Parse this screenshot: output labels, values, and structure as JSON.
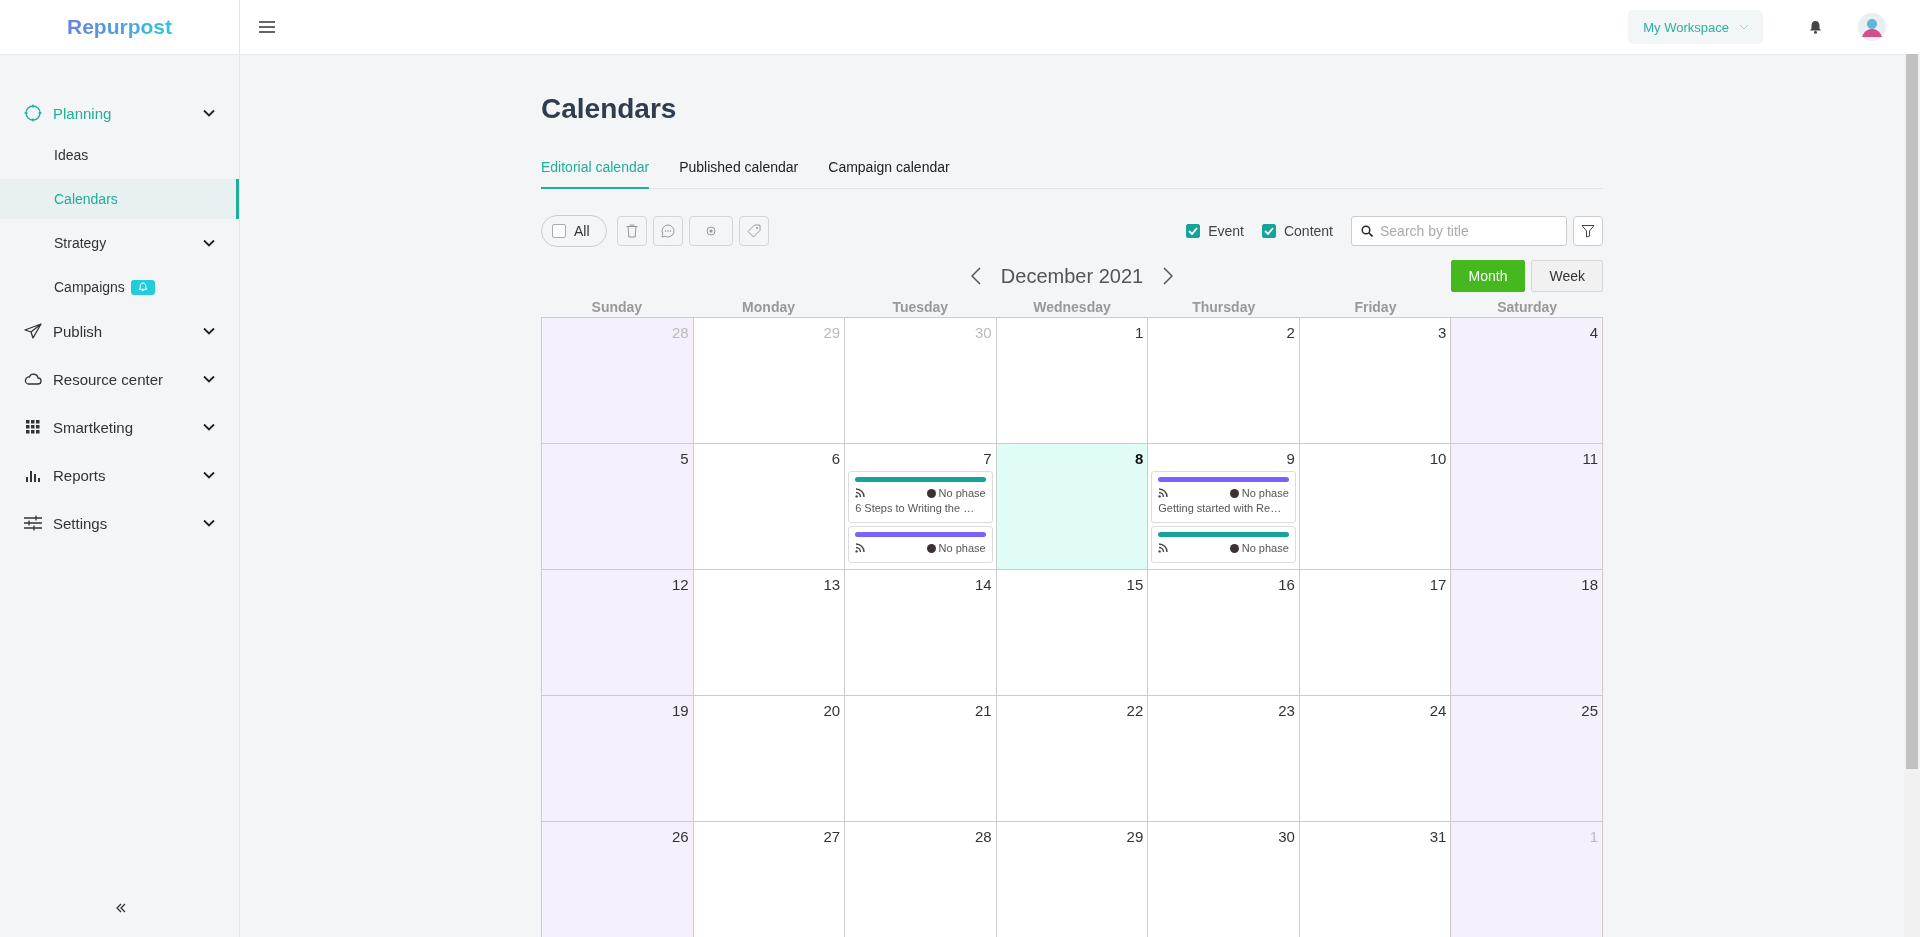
{
  "app": {
    "logo": "Repurpost"
  },
  "header": {
    "workspace": "My Workspace"
  },
  "sidebar": {
    "items": [
      {
        "label": "Planning",
        "selected": true,
        "expandable": true,
        "children": [
          {
            "label": "Ideas",
            "selected": false,
            "expandable": false,
            "badge": false
          },
          {
            "label": "Calendars",
            "selected": true,
            "expandable": false,
            "badge": false
          },
          {
            "label": "Strategy",
            "selected": false,
            "expandable": true,
            "badge": false
          },
          {
            "label": "Campaigns",
            "selected": false,
            "expandable": false,
            "badge": true
          }
        ]
      },
      {
        "label": "Publish",
        "selected": false,
        "expandable": true
      },
      {
        "label": "Resource center",
        "selected": false,
        "expandable": true
      },
      {
        "label": "Smartketing",
        "selected": false,
        "expandable": true
      },
      {
        "label": "Reports",
        "selected": false,
        "expandable": true
      },
      {
        "label": "Settings",
        "selected": false,
        "expandable": true
      }
    ]
  },
  "page": {
    "title": "Calendars"
  },
  "tabs": [
    {
      "label": "Editorial calendar",
      "selected": true
    },
    {
      "label": "Published calendar",
      "selected": false
    },
    {
      "label": "Campaign calendar",
      "selected": false
    }
  ],
  "toolbar": {
    "select_all": {
      "label": "All",
      "checked": false
    },
    "filters": [
      {
        "label": "Event",
        "checked": true
      },
      {
        "label": "Content",
        "checked": true
      }
    ],
    "search": {
      "placeholder": "Search by title"
    }
  },
  "calendar": {
    "month": "December 2021",
    "views": [
      {
        "label": "Month",
        "selected": true
      },
      {
        "label": "Week",
        "selected": false
      }
    ],
    "weekdays": [
      "Sunday",
      "Monday",
      "Tuesday",
      "Wednesday",
      "Thursday",
      "Friday",
      "Saturday"
    ],
    "weeks": [
      [
        {
          "day": "28",
          "outside": true,
          "today": false
        },
        {
          "day": "29",
          "outside": true,
          "today": false
        },
        {
          "day": "30",
          "outside": true,
          "today": false
        },
        {
          "day": "1",
          "outside": false,
          "today": false
        },
        {
          "day": "2",
          "outside": false,
          "today": false
        },
        {
          "day": "3",
          "outside": false,
          "today": false
        },
        {
          "day": "4",
          "outside": false,
          "today": false
        }
      ],
      [
        {
          "day": "5",
          "outside": false,
          "today": false
        },
        {
          "day": "6",
          "outside": false,
          "today": false
        },
        {
          "day": "7",
          "outside": false,
          "today": false,
          "events": [
            {
              "color": "#17a39b",
              "phase": "No phase",
              "title": "6 Steps to Writing the …"
            },
            {
              "color": "#7b61ff",
              "phase": "No phase"
            }
          ]
        },
        {
          "day": "8",
          "outside": false,
          "today": true
        },
        {
          "day": "9",
          "outside": false,
          "today": false,
          "events": [
            {
              "color": "#7b61ff",
              "phase": "No phase",
              "title": "Getting started with Re…"
            },
            {
              "color": "#17a39b",
              "phase": "No phase"
            }
          ]
        },
        {
          "day": "10",
          "outside": false,
          "today": false
        },
        {
          "day": "11",
          "outside": false,
          "today": false
        }
      ],
      [
        {
          "day": "12",
          "outside": false,
          "today": false
        },
        {
          "day": "13",
          "outside": false,
          "today": false
        },
        {
          "day": "14",
          "outside": false,
          "today": false
        },
        {
          "day": "15",
          "outside": false,
          "today": false
        },
        {
          "day": "16",
          "outside": false,
          "today": false
        },
        {
          "day": "17",
          "outside": false,
          "today": false
        },
        {
          "day": "18",
          "outside": false,
          "today": false
        }
      ],
      [
        {
          "day": "19",
          "outside": false,
          "today": false
        },
        {
          "day": "20",
          "outside": false,
          "today": false
        },
        {
          "day": "21",
          "outside": false,
          "today": false
        },
        {
          "day": "22",
          "outside": false,
          "today": false
        },
        {
          "day": "23",
          "outside": false,
          "today": false
        },
        {
          "day": "24",
          "outside": false,
          "today": false
        },
        {
          "day": "25",
          "outside": false,
          "today": false
        }
      ],
      [
        {
          "day": "26",
          "outside": false,
          "today": false
        },
        {
          "day": "27",
          "outside": false,
          "today": false
        },
        {
          "day": "28",
          "outside": false,
          "today": false
        },
        {
          "day": "29",
          "outside": false,
          "today": false
        },
        {
          "day": "30",
          "outside": false,
          "today": false
        },
        {
          "day": "31",
          "outside": false,
          "today": false
        },
        {
          "day": "1",
          "outside": true,
          "today": false
        }
      ]
    ]
  }
}
